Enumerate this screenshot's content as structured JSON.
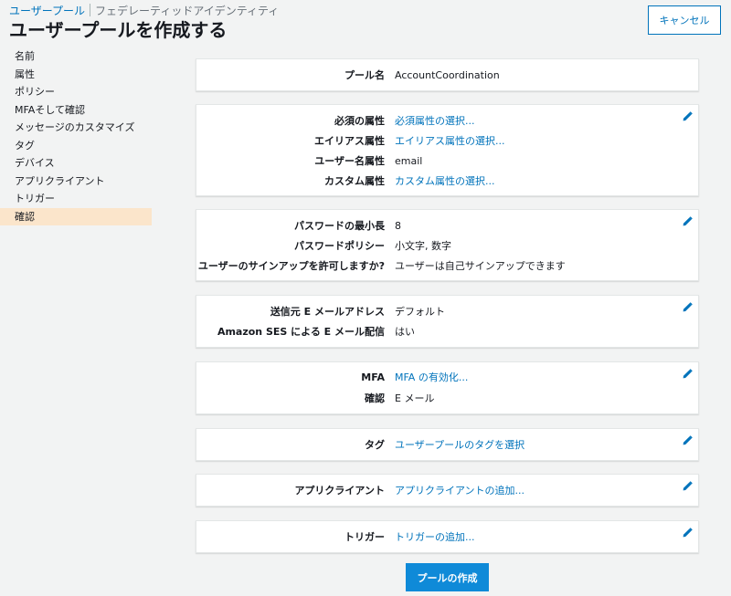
{
  "header": {
    "tab_active": "ユーザープール",
    "tab_inactive": "フェデレーティッドアイデンティティ",
    "title": "ユーザープールを作成する",
    "cancel": "キャンセル"
  },
  "sidebar": {
    "items": [
      {
        "label": "名前"
      },
      {
        "label": "属性"
      },
      {
        "label": "ポリシー"
      },
      {
        "label": "MFAそして確認"
      },
      {
        "label": "メッセージのカスタマイズ"
      },
      {
        "label": "タグ"
      },
      {
        "label": "デバイス"
      },
      {
        "label": "アプリクライアント"
      },
      {
        "label": "トリガー"
      },
      {
        "label": "確認"
      }
    ],
    "active": "確認"
  },
  "pool": {
    "label": "プール名",
    "value": "AccountCoordination"
  },
  "attributes": {
    "required_label": "必須の属性",
    "required_value": "必須属性の選択...",
    "alias_label": "エイリアス属性",
    "alias_value": "エイリアス属性の選択...",
    "username_label": "ユーザー名属性",
    "username_value": "email",
    "custom_label": "カスタム属性",
    "custom_value": "カスタム属性の選択..."
  },
  "policy": {
    "minlen_label": "パスワードの最小長",
    "minlen_value": "8",
    "pwpolicy_label": "パスワードポリシー",
    "pwpolicy_value": "小文字, 数字",
    "signup_label": "ユーザーのサインアップを許可しますか?",
    "signup_value": "ユーザーは自己サインアップできます"
  },
  "email": {
    "from_label": "送信元 E メールアドレス",
    "from_value": "デフォルト",
    "ses_label": "Amazon SES による E メール配信",
    "ses_value": "はい"
  },
  "mfa": {
    "mfa_label": "MFA",
    "mfa_value": "MFA の有効化...",
    "verify_label": "確認",
    "verify_value": "E メール"
  },
  "tags": {
    "label": "タグ",
    "value": "ユーザープールのタグを選択"
  },
  "appclient": {
    "label": "アプリクライアント",
    "value": "アプリクライアントの追加..."
  },
  "triggers": {
    "label": "トリガー",
    "value": "トリガーの追加..."
  },
  "footer": {
    "create": "プールの作成"
  },
  "colors": {
    "accent": "#0073bb",
    "primary_button": "#0f8ad8",
    "active_nav": "#fbe5cb"
  }
}
